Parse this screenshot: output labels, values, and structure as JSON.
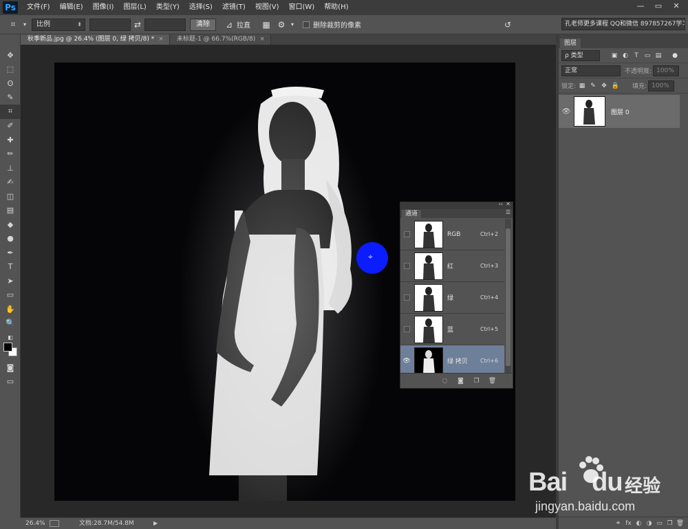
{
  "menubar": {
    "logo": "Ps",
    "items": [
      "文件(F)",
      "编辑(E)",
      "图像(I)",
      "图层(L)",
      "类型(Y)",
      "选择(S)",
      "滤镜(T)",
      "视图(V)",
      "窗口(W)",
      "帮助(H)"
    ],
    "window_controls": [
      "—",
      "▭",
      "✕"
    ]
  },
  "options": {
    "ratio_select": "比例",
    "swap_glyph": "⇄",
    "clear_button": "清除",
    "straighten_label": "拉直",
    "delete_cropped_label": "删除裁剪的像素",
    "info_text": "孔老师更多课程 QQ和微信 897857267学习"
  },
  "doc_tabs": [
    {
      "label": "秋季新品.jpg @ 26.4% (图层 0, 绿 拷贝/8) *",
      "close": "×"
    },
    {
      "label": "未标题-1 @ 66.7%(RGB/8)",
      "close": "×"
    }
  ],
  "toolbar": {
    "tools": [
      "move-tool",
      "marquee-tool",
      "lasso-tool",
      "quick-select-tool",
      "crop-tool",
      "eyedropper-tool",
      "healing-tool",
      "brush-tool",
      "stamp-tool",
      "history-brush-tool",
      "eraser-tool",
      "gradient-tool",
      "blur-tool",
      "dodge-tool",
      "pen-tool",
      "type-tool",
      "path-select-tool",
      "shape-tool",
      "hand-tool",
      "zoom-tool"
    ],
    "glyphs": [
      "✥",
      "⬚",
      "ʘ",
      "✎",
      "⌗",
      "✐",
      "✚",
      "✏",
      "⊥",
      "✍",
      "◫",
      "▤",
      "◆",
      "●",
      "✒",
      "T",
      "➤",
      "▭",
      "✋",
      "🔍"
    ],
    "active_index": 4,
    "fg_color": "#000000",
    "bg_color": "#ffffff"
  },
  "status": {
    "zoom": "26.4%",
    "doc_info": "文档:28.7M/54.8M"
  },
  "layers_panel": {
    "tab": "图层",
    "filter_kind": "ρ 类型",
    "blend_mode": "正常",
    "opacity_label": "不透明度:",
    "opacity_value": "100%",
    "lock_label": "锁定:",
    "fill_label": "填充:",
    "fill_value": "100%",
    "layer_name": "图层 0",
    "footer_icons": [
      "link-icon",
      "fx-icon",
      "mask-icon",
      "adjustment-icon",
      "folder-icon",
      "new-layer-icon",
      "trash-icon"
    ],
    "footer_glyphs": [
      "⚭",
      "fx",
      "◐",
      "◑",
      "▭",
      "❐",
      "🗑"
    ]
  },
  "channels_panel": {
    "tab": "通道",
    "collapse": "‹‹",
    "close": "✕",
    "menu": "☰",
    "rows": [
      {
        "name": "RGB",
        "shortcut": "Ctrl+2"
      },
      {
        "name": "红",
        "shortcut": "Ctrl+3"
      },
      {
        "name": "绿",
        "shortcut": "Ctrl+4"
      },
      {
        "name": "蓝",
        "shortcut": "Ctrl+5"
      },
      {
        "name": "绿 拷贝",
        "shortcut": "Ctrl+6"
      }
    ],
    "selected_index": 4,
    "footer_glyphs": [
      "◌",
      "◙",
      "❐",
      "🗑"
    ]
  },
  "watermark": {
    "brand_left": "Bai",
    "brand_right": "经验",
    "brand_mid": "du",
    "url": "jingyan.baidu.com"
  },
  "colors": {
    "selection": "#6e7f99",
    "cursor_blue": "#0b1cff",
    "ps_blue": "#31a8ff"
  }
}
